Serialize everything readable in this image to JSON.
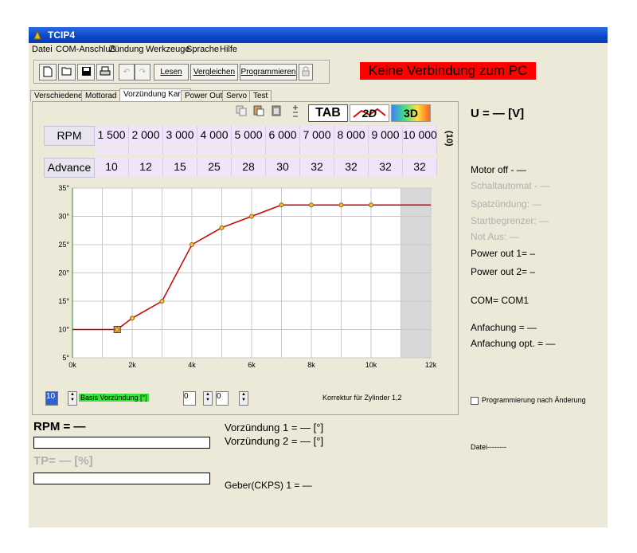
{
  "window": {
    "title": "TCIP4"
  },
  "menu": [
    "Datei",
    "COM-Anschluß",
    "Zündung",
    "Werkzeuge",
    "Sprache",
    "Hilfe"
  ],
  "toolbar": {
    "read_label": "Lesen",
    "compare_label": "Vergleichen",
    "program_label": "Programmieren"
  },
  "status_banner": "Keine Verbindung zum PC",
  "status_banner_color": "#ff0000",
  "tabs": [
    "Verschiedene",
    "Mottorad",
    "Vorzündung Karte",
    "Power Out",
    "Servo",
    "Test"
  ],
  "active_tab": "Vorzündung Karte",
  "grid_toolbar": {
    "tab_label": "TAB",
    "label_2d": "2D",
    "label_3d": "3D"
  },
  "table": {
    "rpm_label": "RPM",
    "advance_label": "Advance",
    "rpm_values": [
      "1 500",
      "2 000",
      "3 000",
      "4 000",
      "5 000",
      "6 000",
      "7 000",
      "8 000",
      "9 000",
      "10 000"
    ],
    "advance_values": [
      "10",
      "12",
      "15",
      "25",
      "28",
      "30",
      "32",
      "32",
      "32",
      "32"
    ],
    "unit_note": "(10)"
  },
  "chart_data": {
    "type": "line",
    "x": [
      0,
      1500,
      2000,
      3000,
      4000,
      5000,
      6000,
      7000,
      8000,
      9000,
      10000,
      12000
    ],
    "values": [
      10,
      10,
      12,
      15,
      25,
      28,
      30,
      32,
      32,
      32,
      32,
      32
    ],
    "markers_x": [
      1500,
      2000,
      3000,
      4000,
      5000,
      6000,
      7000,
      8000,
      9000,
      10000
    ],
    "selected_x": 1500,
    "xlim": [
      0,
      12000
    ],
    "ylim": [
      5,
      35
    ],
    "x_ticks": [
      "0k",
      "2k",
      "4k",
      "6k",
      "8k",
      "10k",
      "12k"
    ],
    "y_ticks": [
      "5°",
      "10°",
      "15°",
      "20°",
      "25°",
      "30°",
      "35°"
    ],
    "shaded_from_x": 11000,
    "line_color": "#cc0000",
    "grid": true
  },
  "bottom_controls": {
    "basis_value": "10",
    "basis_label": "Basis Vorzündung [°]",
    "spin1_value": "0",
    "spin2_value": "0",
    "correction_label": "Korrektur für Zylinder 1,2"
  },
  "right_panel": {
    "voltage": "U = — [V]",
    "motor": "Motor off - —",
    "schaltautomat": "Schaltautomat - —",
    "spatzundung": "Spatzündung: —",
    "startbegrenzer": "Startbegrenzer: —",
    "notaus": "Not Aus: —",
    "power_out_1": "Power out 1= –",
    "power_out_2": "Power out 2= –",
    "com": "COM= COM1",
    "anfachung": "Anfachung = —",
    "anfachung_opt": "Anfachung opt. = —",
    "checkbox_label": "Programmierung nach Änderung",
    "datei": "Datei--------"
  },
  "lower": {
    "rpm": "RPM = —",
    "tp": "TP= — [%]",
    "vorzundung1": "Vorzündung 1 = — [°]",
    "vorzundung2": "Vorzündung 2 = — [°]",
    "geber": "Geber(CKPS) 1 = —"
  }
}
